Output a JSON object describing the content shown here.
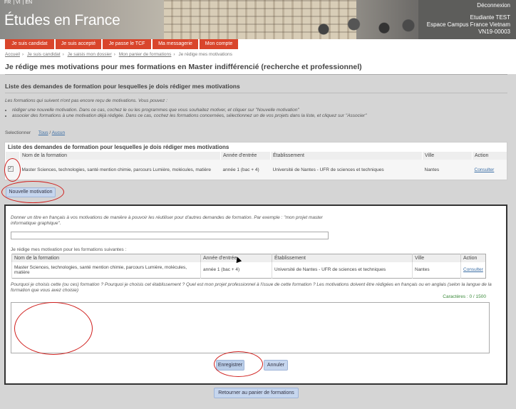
{
  "header": {
    "languages": [
      "FR",
      "VI",
      "EN"
    ],
    "site_title": "Études en France",
    "logout": "Déconnexion",
    "user_lines": [
      "Etudiante TEST",
      "Espace Campus France Vietnam",
      "VN19-00003"
    ]
  },
  "menu": {
    "items": [
      "Je suis candidat",
      "Je suis accepté",
      "Je passe le TCF",
      "Ma messagerie",
      "Mon compte"
    ]
  },
  "breadcrumb": {
    "items": [
      "Accueil",
      "Je suis candidat",
      "Je saisis mon dossier",
      "Mon panier de formations"
    ],
    "current": "Je rédige mes motivations"
  },
  "page": {
    "title": "Je rédige mes motivations pour mes formations en Master indifférencié (recherche et professionnel)",
    "section_title": "Liste des demandes de formation pour lesquelles je dois rédiger mes motivations",
    "intro": "Les formations qui suivent n'ont pas encore reçu de motivations. Vous pouvez :",
    "intro_items": [
      "rédiger une nouvelle motivation. Dans ce cas, cochez le ou les programmes que vous souhaitez motiver, et cliquer sur \"Nouvelle motivation\"",
      "associer des formations à une motivation déjà rédigée. Dans ce cas, cochez les formations concernées, sélectionnez un de vos projets dans la liste, et cliquez sur \"Associer\""
    ],
    "select_label": "Selectionner",
    "select_all": "Tous",
    "select_none": "Aucun"
  },
  "list": {
    "caption": "Liste des demandes de formation pour lesquelles je dois rédiger mes motivations",
    "headers": [
      "Nom de la formation",
      "Année d'entrée",
      "Établissement",
      "Ville",
      "Action"
    ],
    "rows": [
      {
        "name": "Master Sciences, technologies, santé mention chimie, parcours Lumière, molécules, matière",
        "year": "année 1 (bac + 4)",
        "school": "Université de Nantes - UFR de sciences et techniques",
        "city": "Nantes",
        "action": "Consulter"
      }
    ]
  },
  "buttons": {
    "new_motivation": "Nouvelle motivation",
    "save": "Enregistrer",
    "cancel": "Annuler",
    "back": "Retourner au panier de formations"
  },
  "form": {
    "title_instruction": "Donner un titre en français à vos motivations de manière à pouvoir les réutiliser pour d'autres demandes de formation. Par exemple : \"mon projet master informatique graphique\".",
    "title_value": "",
    "formations_label": "Je rédige mes motivation pour les formations suivantes :",
    "headers": [
      "Nom de la formation",
      "Année d'entrée",
      "Établissement",
      "Ville",
      "Action"
    ],
    "row": {
      "name": "Master Sciences, technologies, santé mention chimie, parcours Lumière, molécules, matière",
      "year": "année 1 (bac + 4)",
      "school": "Université de Nantes - UFR de sciences et techniques",
      "city": "Nantes",
      "action": "Consulter"
    },
    "questions": "Pourquoi je choisis cette (ou ces) formation ? Pourquoi je choisis cet établissement ? Quel est mon projet professionnel à l'issue de cette formation ? Les motivations doivent être rédigées en français ou en anglais (selon la langue de la formation que vous avez choisie)",
    "counter": "Caractères : 0 / 1500",
    "motivation_value": ""
  },
  "colors": {
    "accent": "#d9452b",
    "annotation": "#d0201e",
    "button": "#c6d6ee"
  }
}
